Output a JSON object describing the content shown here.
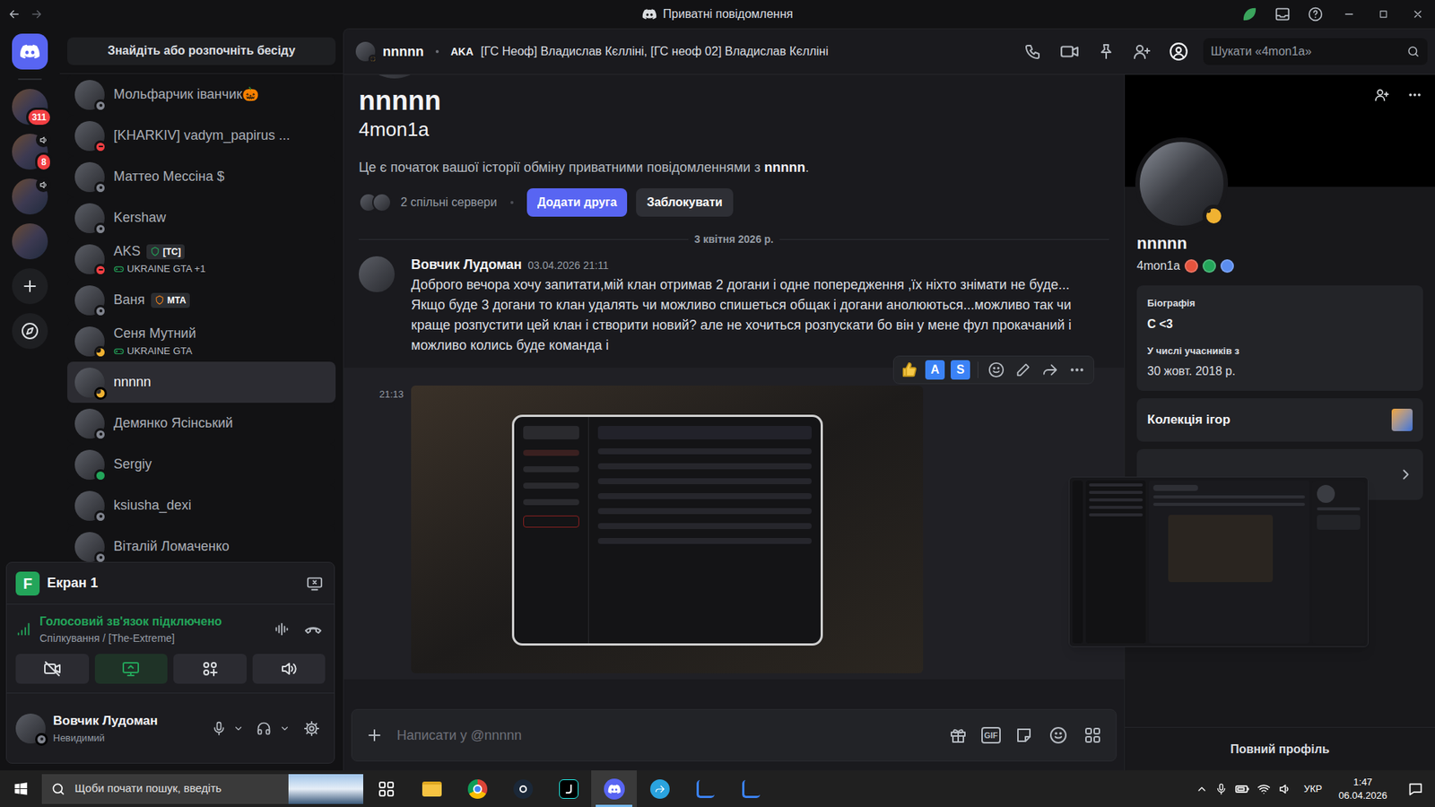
{
  "window": {
    "title": "Приватні повідомлення"
  },
  "rail": {
    "items": [
      {
        "kind": "home",
        "selected": true
      },
      {
        "kind": "server",
        "badge": "311",
        "voice": false,
        "selected": false
      },
      {
        "kind": "server",
        "badge": "8",
        "voice": true,
        "selected": false
      },
      {
        "kind": "server",
        "voice": true,
        "selected": false
      },
      {
        "kind": "server",
        "voice": false,
        "selected": false
      },
      {
        "kind": "add",
        "selected": false
      },
      {
        "kind": "explore",
        "selected": false
      }
    ]
  },
  "dm_list": {
    "search": "Знайдіть або розпочніть бесіду",
    "items": [
      {
        "name": "Мольфарчик іванчик🎃",
        "status": "offline",
        "color": "#80848e",
        "selected": false
      },
      {
        "name": "[KHARKIV] vadym_papirus ...",
        "status": "dnd",
        "color": "#f23f43",
        "selected": false
      },
      {
        "name": "Маттео Мессіна $",
        "status": "offline",
        "color": "#80848e",
        "selected": false
      },
      {
        "name": "Kershaw",
        "status": "offline",
        "color": "#80848e",
        "selected": false
      },
      {
        "name": "AKS",
        "status": "dnd",
        "color": "#f23f43",
        "selected": false,
        "tag": {
          "label": "[TC]",
          "color": "#23a55a"
        },
        "subtitle": "UKRAINE GTA +1"
      },
      {
        "name": "Ваня",
        "status": "offline",
        "color": "#80848e",
        "selected": false,
        "tag": {
          "label": "MTA",
          "color": "#f0801a"
        }
      },
      {
        "name": "Сеня Мутний",
        "status": "idle",
        "color": "#f0b232",
        "selected": false,
        "subtitle": "UKRAINE GTA"
      },
      {
        "name": "nnnnn",
        "status": "idle",
        "color": "#f0b232",
        "selected": true
      },
      {
        "name": "Демянко Ясінський",
        "status": "offline",
        "color": "#80848e",
        "selected": false
      },
      {
        "name": "Sergiy",
        "status": "online",
        "color": "#23a55a",
        "selected": false
      },
      {
        "name": "ksiusha_dexi",
        "status": "offline",
        "color": "#80848e",
        "selected": false
      },
      {
        "name": "Віталій Ломаченко",
        "status": "offline",
        "color": "#80848e",
        "selected": false
      }
    ]
  },
  "voice_panel": {
    "icon_letter": "F",
    "stream_title": "Екран 1",
    "status": "Голосовий зв'язок підключено",
    "channel": "Спілкування / [The-Extreme]",
    "buttons": [
      {
        "kind": "camera",
        "active": false
      },
      {
        "kind": "screen",
        "active": true
      },
      {
        "kind": "activities",
        "active": false
      },
      {
        "kind": "soundboard",
        "active": false
      }
    ]
  },
  "user": {
    "name": "Вовчик Лудоман",
    "status": "Невидимий",
    "status_kind": "offline",
    "status_color": "#80848e"
  },
  "chat_header": {
    "name": "nnnnn",
    "status": "idle",
    "status_color": "#f0b232",
    "aka_label": "AKA",
    "aka": "[ГС Неоф] Владислав Кєлліні, [ГС неоф 02] Владислав Кєлліні",
    "search_placeholder": "Шукати «4mon1a»"
  },
  "intro": {
    "display_name": "nnnnn",
    "username": "4mon1a",
    "text_before": "Це є початок вашої історії обміну приватними повідомленнями з ",
    "text_name": "nnnnn",
    "text_after": ".",
    "mutual_servers": "2 спільні сервери",
    "buttons": [
      {
        "label": "Додати друга",
        "primary": true
      },
      {
        "label": "Заблокувати",
        "primary": false
      }
    ]
  },
  "date_divider": "3 квітня 2026 р.",
  "message": {
    "author": "Вовчик Лудоман",
    "timestamp": "03.04.2026 21:11",
    "text": "Доброго вечора хочу запитати,мій клан отримав 2 догани і одне попередження ,їх ніхто знімати не буде... Якщо буде 3 догани то клан удалять чи можливо спишеться общак і догани анолюються...можливо так чи краще розпустити цей клан і створити новий? але не хочиться розпускати бо він у мене фул прокачаний і можливо колись буде команда і"
  },
  "attachment_message": {
    "time": "21:13",
    "hovered": true
  },
  "hover_toolbar": {
    "reaction_letters": [
      "A",
      "S"
    ]
  },
  "input": {
    "placeholder": "Написати у @nnnnn",
    "gif_label": "GIF"
  },
  "profile": {
    "display_name": "nnnnn",
    "username": "4mon1a",
    "status": "idle",
    "status_color": "#f0b232",
    "badges": [
      {
        "color": "#e5533d"
      },
      {
        "color": "#23a55a"
      },
      {
        "color": "#5b8def"
      }
    ],
    "bio_label": "Біографія",
    "bio": "C <3",
    "member_since_label": "У числі учасників з",
    "member_since": "30 жовт. 2018 р.",
    "games_label": "Колекція ігор",
    "full_profile": "Повний профіль"
  },
  "taskbar": {
    "search_placeholder": "Щоби почати пошук, введіть",
    "apps": [
      {
        "kind": "task-view",
        "active": false
      },
      {
        "kind": "explorer",
        "active": false
      },
      {
        "kind": "chrome",
        "active": false
      },
      {
        "kind": "steam",
        "active": false
      },
      {
        "kind": "tiktok",
        "active": false
      },
      {
        "kind": "discord",
        "active": true
      },
      {
        "kind": "telegram",
        "active": false
      },
      {
        "kind": "lapp",
        "active": false
      },
      {
        "kind": "lapp",
        "active": false
      }
    ],
    "language": "УКР",
    "time": "1:47",
    "date": "06.04.2026"
  }
}
